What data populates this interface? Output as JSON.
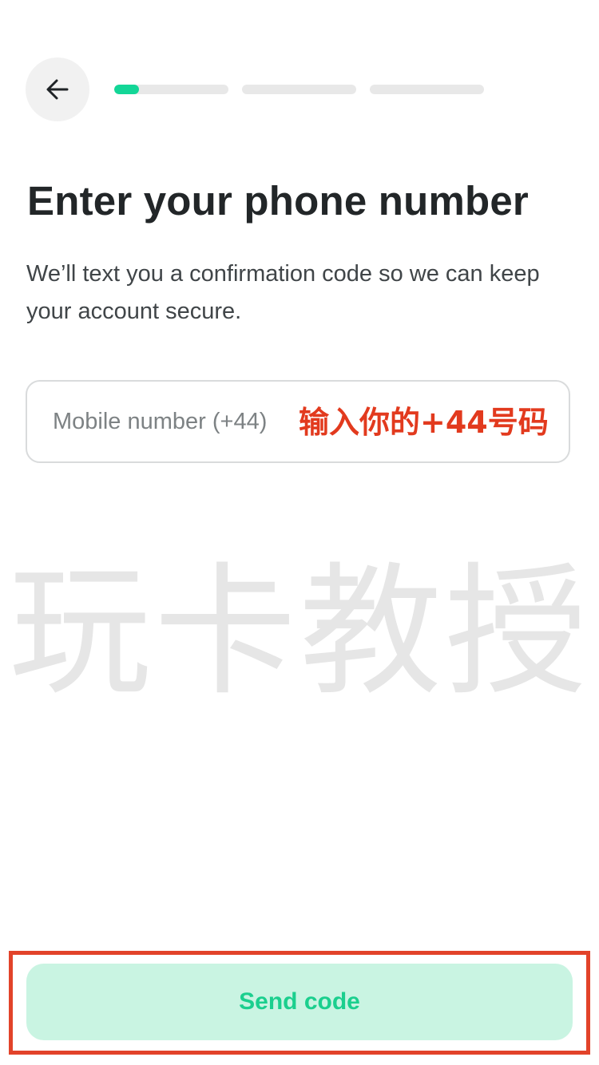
{
  "header": {
    "back_icon": "arrow-left-icon",
    "progress": {
      "total_steps": 3,
      "current_step": 1,
      "current_step_fill": 0.22,
      "active_color": "#13d697",
      "inactive_color": "#e8e8e8"
    }
  },
  "main": {
    "title": "Enter your phone number",
    "subtitle": "We’ll text you a confirmation code so we can keep your account secure.",
    "phone_input": {
      "placeholder": "Mobile number (+44)",
      "value": ""
    },
    "annotation": "输入你的+44号码",
    "watermark": "玩卡教授"
  },
  "footer": {
    "send_button_label": "Send code",
    "button_bg": "#c9f4e2",
    "button_text_color": "#1bcf8e",
    "highlight_color": "#e2432a"
  }
}
